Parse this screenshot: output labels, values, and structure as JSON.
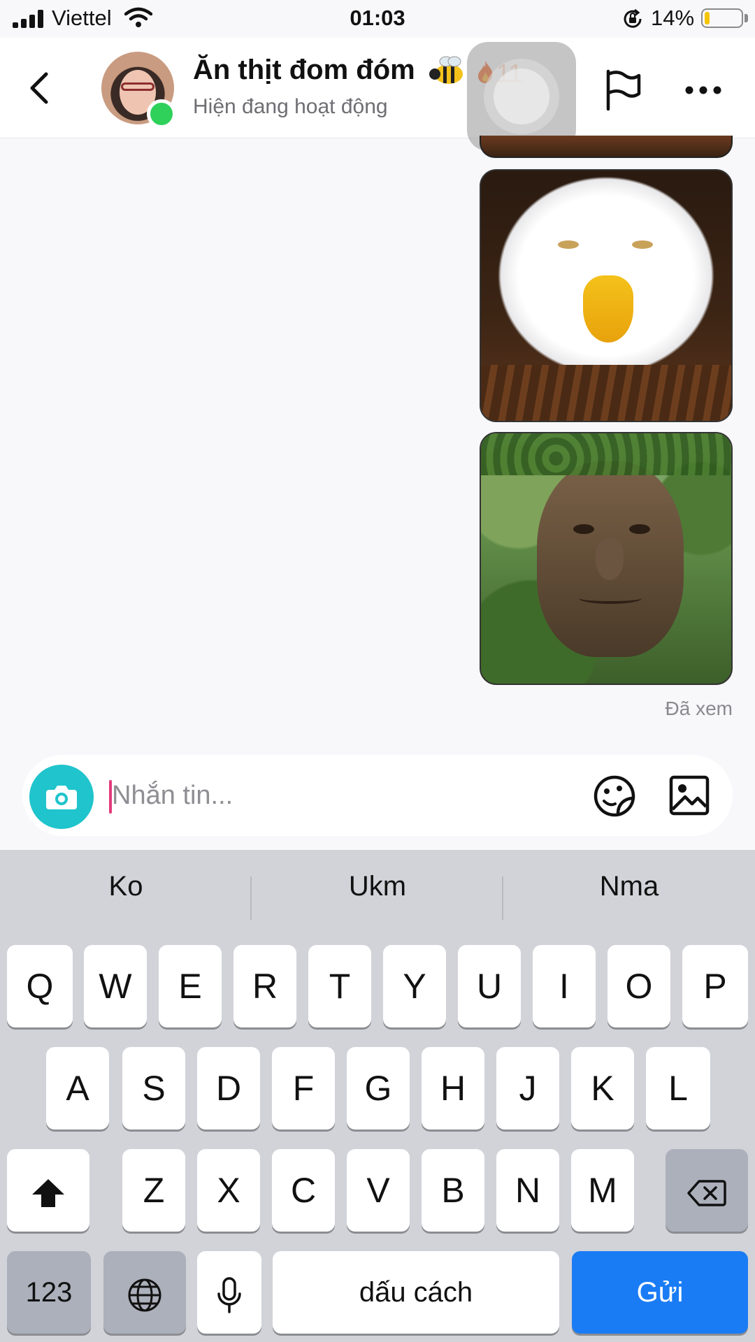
{
  "status_bar": {
    "carrier": "Viettel",
    "time": "01:03",
    "battery_percent": "14%",
    "battery_level": 0.14
  },
  "header": {
    "chat_name": "Ăn thịt đom đóm",
    "name_emoji": "bee-icon",
    "streak_count": "11",
    "streak_icon": "fire-icon",
    "status": "Hiện đang hoạt động",
    "online_color": "#2fd15b"
  },
  "messages": {
    "items": [
      {
        "type": "image",
        "subject": "eagle-meme"
      },
      {
        "type": "image",
        "subject": "wise-tree-meme"
      }
    ],
    "seen_label": "Đã xem"
  },
  "composer": {
    "placeholder": "Nhắn tin...",
    "value": "",
    "camera_color": "#1fc4cc"
  },
  "keyboard": {
    "suggestions": [
      "Ko",
      "Ukm",
      "Nma"
    ],
    "row1": [
      "Q",
      "W",
      "E",
      "R",
      "T",
      "Y",
      "U",
      "I",
      "O",
      "P"
    ],
    "row2": [
      "A",
      "S",
      "D",
      "F",
      "G",
      "H",
      "J",
      "K",
      "L"
    ],
    "row3": [
      "Z",
      "X",
      "C",
      "V",
      "B",
      "N",
      "M"
    ],
    "numbers_label": "123",
    "space_label": "dấu cách",
    "send_label": "Gửi",
    "send_color": "#1a7cf5"
  }
}
